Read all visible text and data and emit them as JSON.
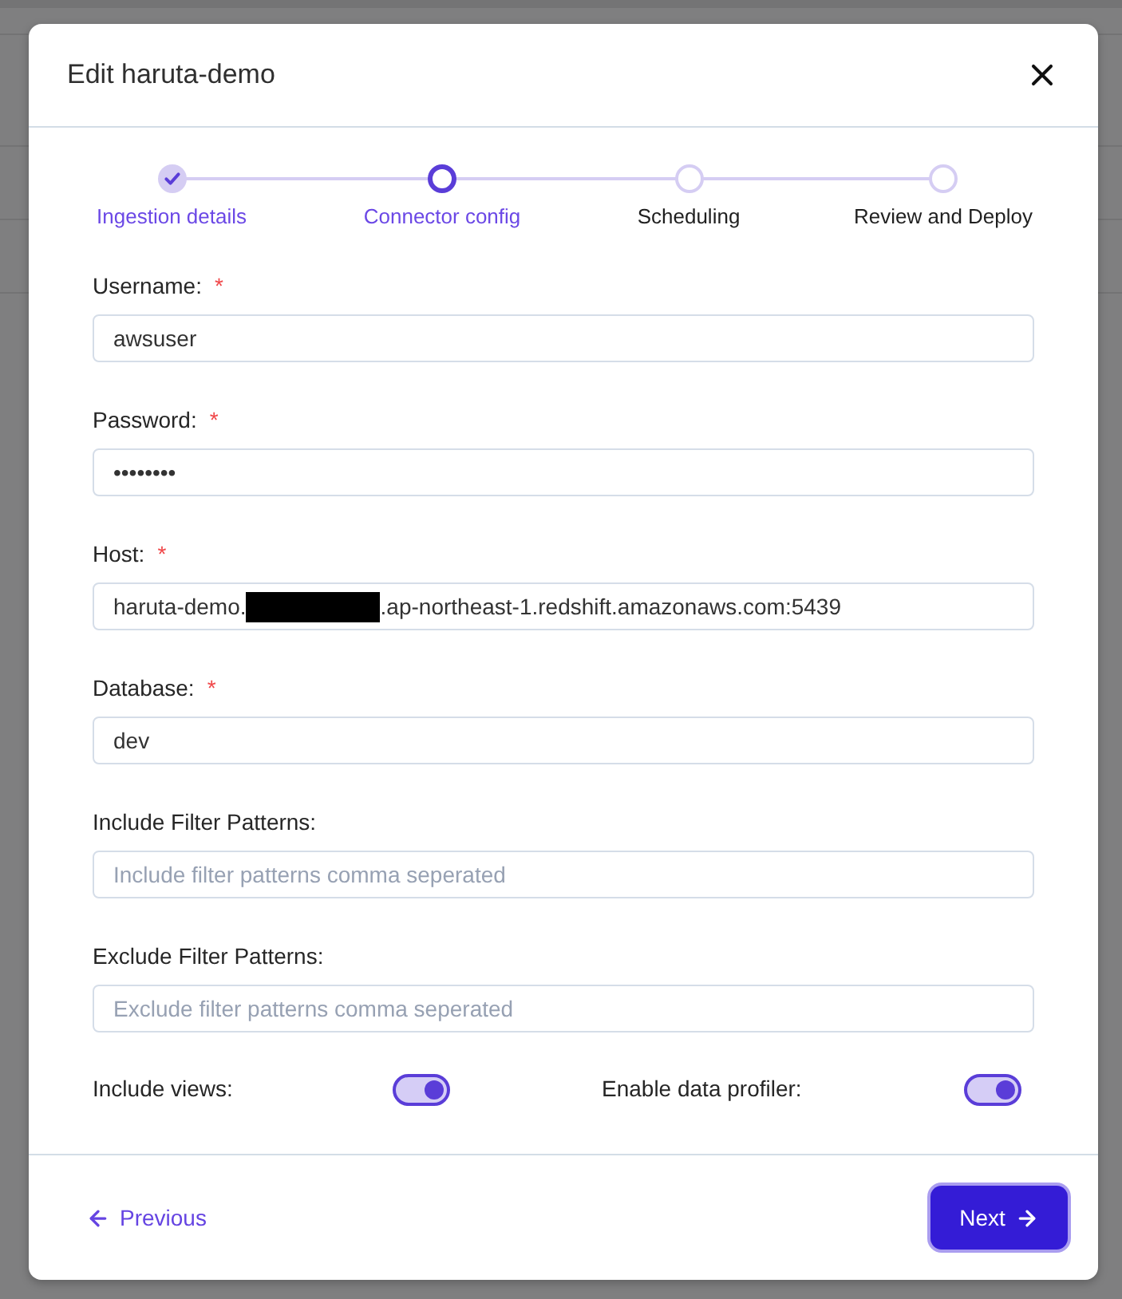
{
  "dialog": {
    "title": "Edit haruta-demo"
  },
  "steps": [
    {
      "label": "Ingestion details",
      "completed": true,
      "selected": false
    },
    {
      "label": "Connector config",
      "completed": false,
      "selected": true
    },
    {
      "label": "Scheduling",
      "completed": false,
      "selected": false
    },
    {
      "label": "Review and Deploy",
      "completed": false,
      "selected": false
    }
  ],
  "fields": [
    {
      "label": "Username:",
      "required_mark": "*",
      "value": "awsuser"
    },
    {
      "label": "Password:",
      "required_mark": "*",
      "value": "••••••••"
    },
    {
      "label": "Host:",
      "required_mark": "*",
      "value_parts": [
        "haruta-demo.",
        ".ap-northeast-1.redshift.amazonaws.com:5439"
      ],
      "redacted": true
    },
    {
      "label": "Database:",
      "required_mark": "*",
      "value": "dev"
    },
    {
      "label": "Include Filter Patterns:",
      "placeholder": "Include filter patterns comma seperated"
    },
    {
      "label": "Exclude Filter Patterns:",
      "placeholder": "Exclude filter patterns comma seperated"
    }
  ],
  "toggles": [
    {
      "label": "Include views:",
      "on": true
    },
    {
      "label": "Enable data profiler:",
      "on": true
    }
  ],
  "footer": {
    "previous": "Previous",
    "next": "Next"
  }
}
